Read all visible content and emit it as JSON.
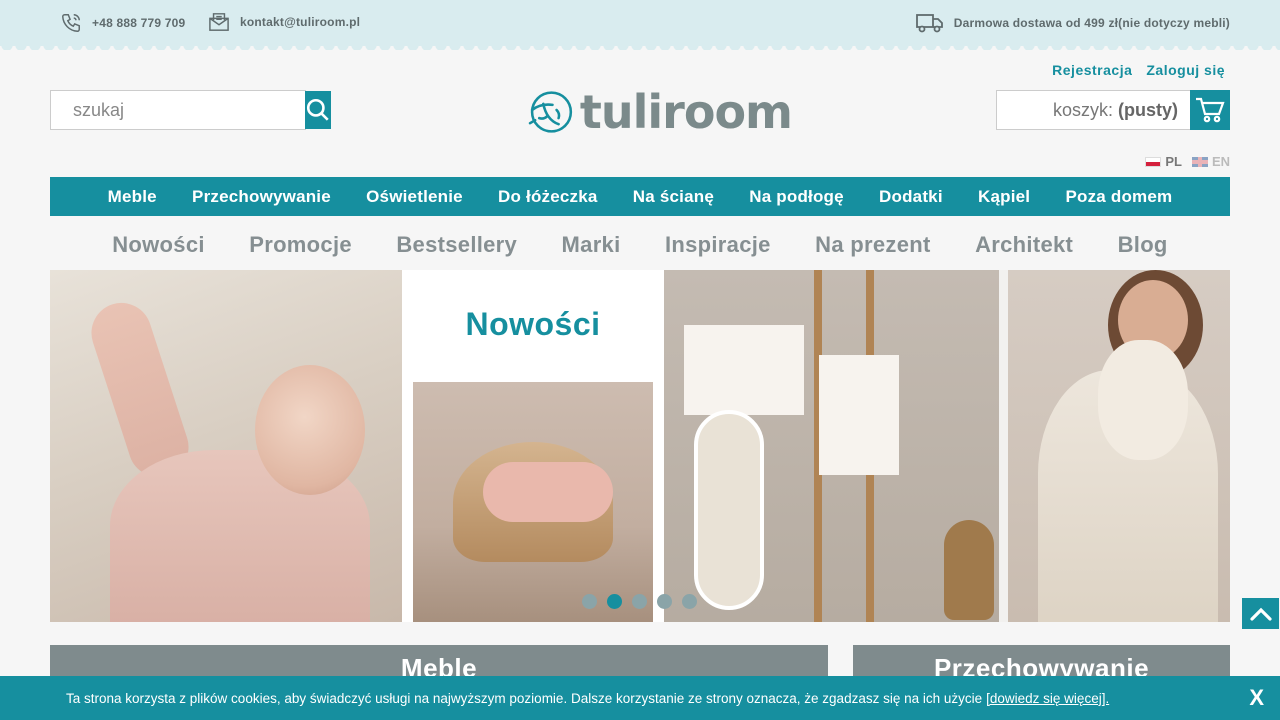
{
  "topbar": {
    "phone": "+48 888 779 709",
    "email": "kontakt@tuliroom.pl",
    "shipping": "Darmowa dostawa od 499 zł(nie dotyczy mebli)"
  },
  "auth": {
    "register": "Rejestracja",
    "login": "Zaloguj się"
  },
  "search": {
    "placeholder": "szukaj"
  },
  "logo": {
    "text": "tuliroom"
  },
  "cart": {
    "label": "koszyk:",
    "status": "(pusty)"
  },
  "languages": {
    "pl": "PL",
    "en": "EN"
  },
  "category_nav": [
    "Meble",
    "Przechowywanie",
    "Oświetlenie",
    "Do łóżeczka",
    "Na ścianę",
    "Na podłogę",
    "Dodatki",
    "Kąpiel",
    "Poza domem"
  ],
  "secondary_nav": [
    "Nowości",
    "Promocje",
    "Bestsellery",
    "Marki",
    "Inspiracje",
    "Na prezent",
    "Architekt",
    "Blog"
  ],
  "banner": {
    "title": "Nowości",
    "slide_count": 5,
    "active_slide": 2
  },
  "tiles": [
    "Meble",
    "Przechowywanie"
  ],
  "cookie": {
    "text": "Ta strona korzysta z plików cookies, aby świadczyć usługi na najwyższym poziomie. Dalsze korzystanie ze strony oznacza, że zgadzasz się na ich użycie",
    "link": "[dowiedz się więcej].",
    "close": "X"
  },
  "colors": {
    "brand": "#168f9f",
    "topbar": "#d9ecef",
    "tile": "#7f8b8d"
  }
}
